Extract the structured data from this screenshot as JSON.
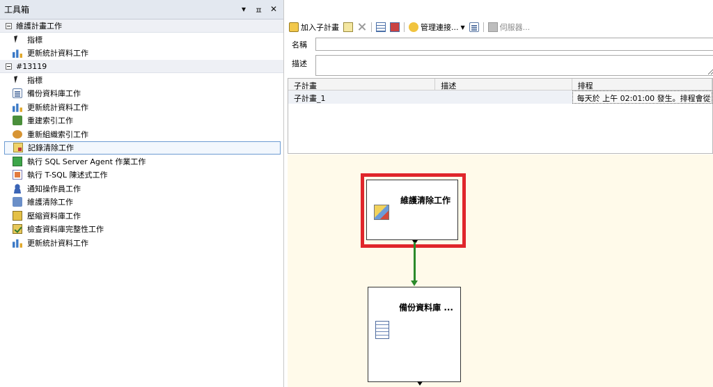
{
  "toolbox": {
    "title": "工具箱",
    "controls": {
      "dropdown": "▾",
      "pin": "ㅍ",
      "close": "✕"
    },
    "groups": [
      {
        "label": "維護計畫工作",
        "items": [
          {
            "label": "指標",
            "icon": "pointer-icon"
          },
          {
            "label": "更新統計資料工作",
            "icon": "statistics-icon"
          }
        ]
      },
      {
        "label": "#13119",
        "items": [
          {
            "label": "指標",
            "icon": "pointer-icon"
          },
          {
            "label": "備份資料庫工作",
            "icon": "backup-database-icon"
          },
          {
            "label": "更新統計資料工作",
            "icon": "statistics-icon"
          },
          {
            "label": "重建索引工作",
            "icon": "rebuild-index-icon"
          },
          {
            "label": "重新組織索引工作",
            "icon": "reorganize-index-icon"
          },
          {
            "label": "記錄清除工作",
            "icon": "history-cleanup-icon",
            "selected": true
          },
          {
            "label": "執行 SQL Server Agent 作業工作",
            "icon": "agent-job-icon"
          },
          {
            "label": "執行 T-SQL 陳述式工作",
            "icon": "tsql-icon"
          },
          {
            "label": "通知操作員工作",
            "icon": "notify-operator-icon"
          },
          {
            "label": "維護清除工作",
            "icon": "maintenance-cleanup-icon"
          },
          {
            "label": "壓縮資料庫工作",
            "icon": "shrink-database-icon"
          },
          {
            "label": "檢查資料庫完整性工作",
            "icon": "check-integrity-icon"
          },
          {
            "label": "更新統計資料工作",
            "icon": "statistics-icon"
          }
        ]
      }
    ]
  },
  "toolbar": {
    "add_subplan": "加入子計畫",
    "manage_connections": "管理連接...",
    "servers": "伺服器..."
  },
  "form": {
    "name_label": "名稱",
    "name_value": "",
    "description_label": "描述",
    "description_value": ""
  },
  "subplan_grid": {
    "columns": [
      "子計畫",
      "描述",
      "排程"
    ],
    "rows": [
      {
        "subplan": "子計畫_1",
        "description": "",
        "schedule": "每天於 上午 02:01:00 發生。排程會從"
      }
    ]
  },
  "designer": {
    "tasks": [
      {
        "title": "維護清除工作",
        "icon": "maintenance-cleanup-icon",
        "highlighted": true
      },
      {
        "title": "備份資料庫 ...",
        "icon": "backup-database-icon"
      }
    ],
    "connector_color": "#2a8a2a",
    "highlight_color": "#e0262b",
    "canvas_color": "#fffaea"
  }
}
